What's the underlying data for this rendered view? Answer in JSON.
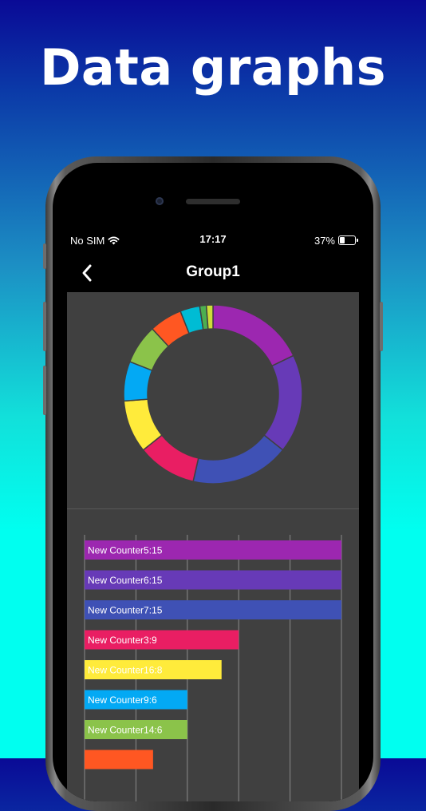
{
  "headline": "Data graphs",
  "status_bar": {
    "carrier": "No SIM",
    "time": "17:17",
    "battery": "37%"
  },
  "nav": {
    "title": "Group1",
    "back_icon": "chevron-left-icon"
  },
  "chart_data": [
    {
      "type": "pie",
      "style": "donut",
      "segments": [
        {
          "value": 15,
          "color": "#9c27b0"
        },
        {
          "value": 15,
          "color": "#673ab7"
        },
        {
          "value": 15,
          "color": "#3f51b5"
        },
        {
          "value": 9,
          "color": "#e91e63"
        },
        {
          "value": 8,
          "color": "#ffeb3b"
        },
        {
          "value": 6,
          "color": "#03a9f4"
        },
        {
          "value": 6,
          "color": "#8bc34a"
        },
        {
          "value": 5,
          "color": "#ff5722"
        },
        {
          "value": 3,
          "color": "#00bcd4"
        },
        {
          "value": 1,
          "color": "#4caf50"
        },
        {
          "value": 1,
          "color": "#cddc39"
        }
      ]
    },
    {
      "type": "bar",
      "orientation": "horizontal",
      "xlim": [
        0,
        15
      ],
      "grid": true,
      "bars": [
        {
          "label": "New Counter5:15",
          "value": 15,
          "color": "#9c27b0"
        },
        {
          "label": "New Counter6:15",
          "value": 15,
          "color": "#673ab7"
        },
        {
          "label": "New Counter7:15",
          "value": 15,
          "color": "#3f51b5"
        },
        {
          "label": "New Counter3:9",
          "value": 9,
          "color": "#e91e63"
        },
        {
          "label": "New Counter16:8",
          "value": 8,
          "color": "#ffeb3b"
        },
        {
          "label": "New Counter9:6",
          "value": 6,
          "color": "#03a9f4"
        },
        {
          "label": "New Counter14:6",
          "value": 6,
          "color": "#8bc34a"
        },
        {
          "label": "",
          "value": 4,
          "color": "#ff5722"
        }
      ]
    }
  ]
}
